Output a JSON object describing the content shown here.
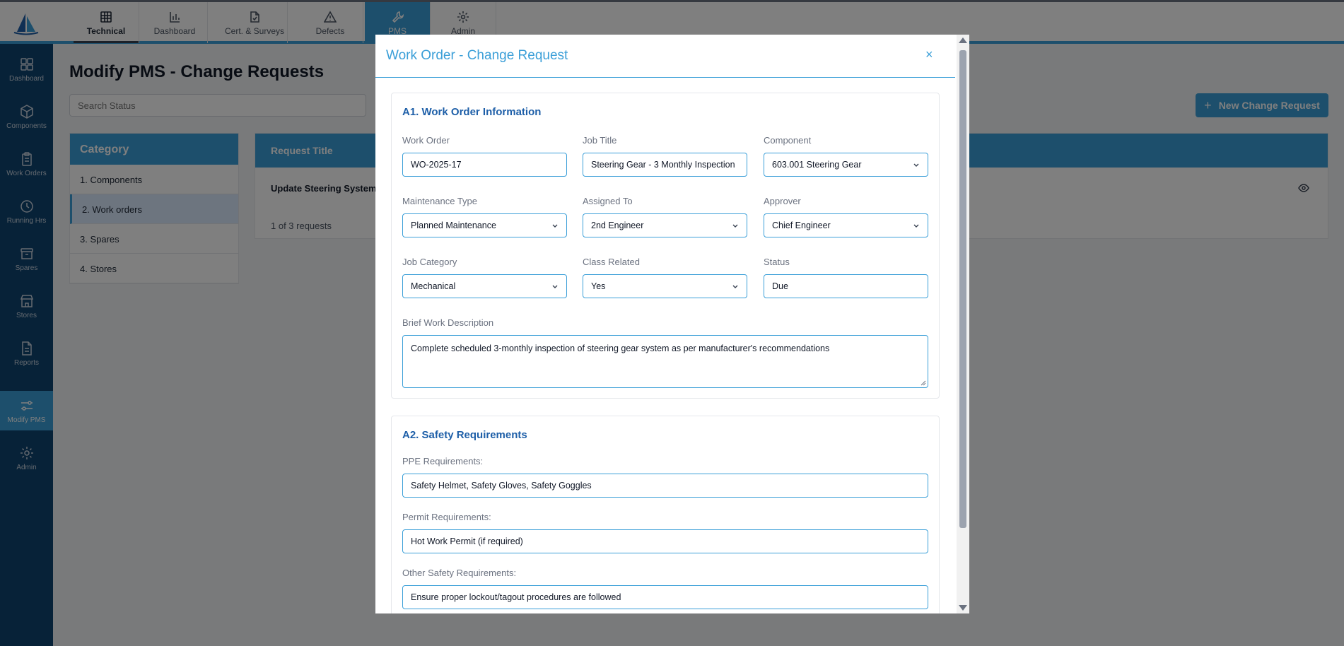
{
  "topnav": {
    "tabs": [
      {
        "label": "Technical",
        "icon": "grid-icon"
      },
      {
        "label": "Dashboard",
        "icon": "bar-chart-icon"
      },
      {
        "label": "Cert. & Surveys",
        "icon": "certificate-icon"
      },
      {
        "label": "Defects",
        "icon": "warning-icon"
      },
      {
        "label": "PMS",
        "icon": "wrench-icon"
      },
      {
        "label": "Admin",
        "icon": "gear-icon"
      }
    ]
  },
  "sidebar": {
    "items": [
      {
        "label": "Dashboard"
      },
      {
        "label": "Components"
      },
      {
        "label": "Work Orders"
      },
      {
        "label": "Running Hrs"
      },
      {
        "label": "Spares"
      },
      {
        "label": "Stores"
      },
      {
        "label": "Reports"
      },
      {
        "label": "Modify PMS"
      },
      {
        "label": "Admin"
      }
    ]
  },
  "main": {
    "title": "Modify PMS - Change Requests",
    "search_placeholder": "Search Status",
    "new_button": "New Change Request",
    "category": {
      "header": "Category",
      "items": [
        "1.  Components",
        "2.  Work orders",
        "3.  Spares",
        "4.  Stores"
      ]
    },
    "requests": {
      "header": "Request Title",
      "row_title": "Update Steering System C",
      "count": "1 of 3 requests"
    }
  },
  "modal": {
    "title": "Work Order - Change Request",
    "close": "×",
    "section_a1": {
      "title": "A1. Work Order Information",
      "work_order_label": "Work Order",
      "work_order_value": "WO-2025-17",
      "job_title_label": "Job Title",
      "job_title_value": "Steering Gear - 3 Monthly Inspection",
      "component_label": "Component",
      "component_value": "603.001 Steering Gear",
      "maintenance_type_label": "Maintenance Type",
      "maintenance_type_value": "Planned Maintenance",
      "assigned_to_label": "Assigned To",
      "assigned_to_value": "2nd Engineer",
      "approver_label": "Approver",
      "approver_value": "Chief Engineer",
      "job_category_label": "Job Category",
      "job_category_value": "Mechanical",
      "class_related_label": "Class Related",
      "class_related_value": "Yes",
      "status_label": "Status",
      "status_value": "Due",
      "description_label": "Brief Work Description",
      "description_value": "Complete scheduled 3-monthly inspection of steering gear system as per manufacturer's recommendations"
    },
    "section_a2": {
      "title": "A2. Safety Requirements",
      "ppe_label": "PPE Requirements:",
      "ppe_value": "Safety Helmet, Safety Gloves, Safety Goggles",
      "permit_label": "Permit Requirements:",
      "permit_value": "Hot Work Permit (if required)",
      "other_label": "Other Safety Requirements:",
      "other_value": "Ensure proper lockout/tagout procedures are followed"
    }
  }
}
